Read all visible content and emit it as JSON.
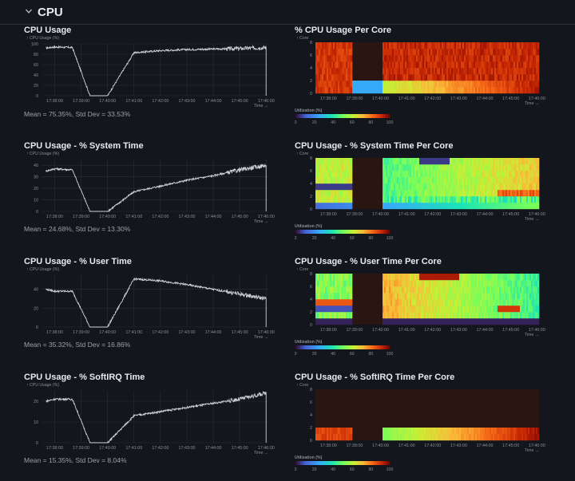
{
  "section": {
    "title": "CPU",
    "icon": "chevron-down-icon"
  },
  "colors": {
    "line": "#cfd3d8",
    "grid": "#2b2f37",
    "axis": "#8a9099",
    "bg": "#13161c",
    "heat_bg": "#2b1512"
  },
  "time_ticks": [
    "17:38:00",
    "17:39:00",
    "17:40:00",
    "17:41:00",
    "17:42:00",
    "17:43:00",
    "17:44:00",
    "17:45:00",
    "17:46:00"
  ],
  "time_axis_label": "Time →",
  "y_axis_label": "↑ CPU Usage (%)",
  "core_axis_label": "↑ Core",
  "legend": {
    "title": "Utilization (%)",
    "ticks": [
      "0",
      "20",
      "40",
      "60",
      "80",
      "100"
    ]
  },
  "line_charts": [
    {
      "title": "CPU Usage",
      "stats": "Mean = 75.35%, Std Dev = 33.53%",
      "y_ticks": [
        "0",
        "20",
        "40",
        "60",
        "80",
        "100"
      ],
      "chart_data": {
        "type": "line",
        "x": [
          "17:37:40",
          "17:38:00",
          "17:38:40",
          "17:39:20",
          "17:40:00",
          "17:41:00",
          "17:42:00",
          "17:43:00",
          "17:44:00",
          "17:45:00",
          "17:46:00"
        ],
        "y": [
          92,
          94,
          93,
          0,
          0,
          83,
          87,
          89,
          90,
          91,
          93
        ],
        "ylim": [
          0,
          100
        ]
      }
    },
    {
      "title": "CPU Usage - % System Time",
      "stats": "Mean = 24.68%, Std Dev = 13.30%",
      "y_ticks": [
        "0",
        "10",
        "20",
        "30",
        "40"
      ],
      "chart_data": {
        "type": "line",
        "x": [
          "17:37:40",
          "17:38:00",
          "17:38:40",
          "17:39:20",
          "17:40:00",
          "17:41:00",
          "17:42:00",
          "17:43:00",
          "17:44:00",
          "17:45:00",
          "17:46:00"
        ],
        "y": [
          35,
          37,
          36,
          0,
          0,
          17,
          22,
          27,
          31,
          36,
          40
        ],
        "ylim": [
          0,
          45
        ]
      }
    },
    {
      "title": "CPU Usage - % User Time",
      "stats": "Mean = 35.32%, Std Dev = 16.86%",
      "y_ticks": [
        "0",
        "20",
        "40"
      ],
      "chart_data": {
        "type": "line",
        "x": [
          "17:37:40",
          "17:38:00",
          "17:38:40",
          "17:39:20",
          "17:40:00",
          "17:41:00",
          "17:42:00",
          "17:43:00",
          "17:44:00",
          "17:45:00",
          "17:46:00"
        ],
        "y": [
          40,
          38,
          38,
          0,
          0,
          51,
          49,
          45,
          40,
          35,
          30
        ],
        "ylim": [
          0,
          55
        ]
      }
    },
    {
      "title": "CPU Usage - % SoftIRQ Time",
      "stats": "Mean = 15.35%, Std Dev = 8.04%",
      "y_ticks": [
        "0",
        "10",
        "20"
      ],
      "chart_data": {
        "type": "line",
        "x": [
          "17:37:40",
          "17:38:00",
          "17:38:40",
          "17:39:20",
          "17:40:00",
          "17:41:00",
          "17:42:00",
          "17:43:00",
          "17:44:00",
          "17:45:00",
          "17:46:00"
        ],
        "y": [
          20,
          21,
          21,
          0,
          0,
          13,
          15,
          17,
          19,
          21,
          24
        ],
        "ylim": [
          0,
          25
        ]
      }
    }
  ],
  "heatmaps": [
    {
      "title": "% CPU Usage Per Core",
      "core_ticks": [
        "0",
        "2",
        "4",
        "6",
        "8"
      ],
      "chart_data": {
        "type": "heatmap",
        "pattern": "usage"
      }
    },
    {
      "title": "CPU Usage - % System Time Per Core",
      "core_ticks": [
        "0",
        "2",
        "4",
        "6",
        "8"
      ],
      "chart_data": {
        "type": "heatmap",
        "pattern": "system"
      }
    },
    {
      "title": "CPU Usage - % User Time Per Core",
      "core_ticks": [
        "0",
        "2",
        "4",
        "6",
        "8"
      ],
      "chart_data": {
        "type": "heatmap",
        "pattern": "user"
      }
    },
    {
      "title": "CPU Usage - % SoftIRQ Time Per Core",
      "core_ticks": [
        "0",
        "2",
        "4",
        "6",
        "8"
      ],
      "chart_data": {
        "type": "heatmap",
        "pattern": "softirq"
      }
    }
  ]
}
